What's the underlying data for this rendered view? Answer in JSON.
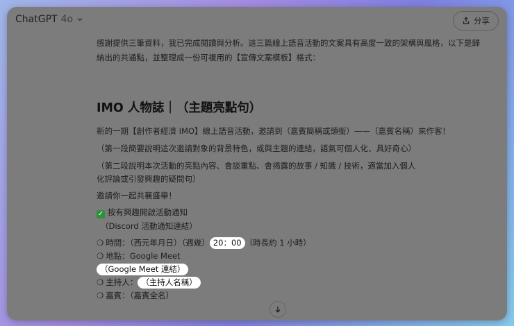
{
  "header": {
    "app_name": "ChatGPT",
    "model": "4o",
    "share_label": "分享"
  },
  "message": {
    "intro_line1": "感謝提供三筆資料，我已完成閱讀與分析。這三篇線上語音活動的文案具有高度一致的架構與風格，以下是歸",
    "intro_line2": "納出的共通點，並整理成一份可複用的【宣傳文案模板】格式：",
    "heading": "IMO 人物誌｜（主題亮點句）",
    "p1": "新的一期【創作者經濟 IMO】線上語音活動，邀請到（嘉賓簡稱或頭銜）——（嘉賓名稱）來作客！",
    "p2": "（第一段簡要說明這次邀請對象的背景特色，或與主題的連結，語氣可個人化、具好奇心）",
    "p3": "（第二段說明本次活動的亮點內容、會談重點、會揭露的故事 / 知識 / 技術，適當加入個人化評論或引發興趣的疑問句）",
    "p4": "邀請你一起共襄盛舉！",
    "notify_label": "按有興趣開啟活動通知",
    "discord_link": "（Discord 活動通知連結）",
    "time_prefix": "時間：（西元年月日）（週幾）",
    "time_value": "20：00",
    "time_suffix": "（時長約 1 小時）",
    "place_label": "地點：Google Meet",
    "meet_link": "（Google Meet 連結）",
    "host_prefix": "主持人：",
    "host_value": "（主持人名稱）",
    "guest_label": "嘉賓：（嘉賓全名）",
    "bullet_symbol": "❍",
    "check_symbol": "✓"
  },
  "colors": {
    "overlay_bg": "#7c7c7c",
    "pill_bg": "#ffffff",
    "check_green": "#2f8f3a"
  }
}
